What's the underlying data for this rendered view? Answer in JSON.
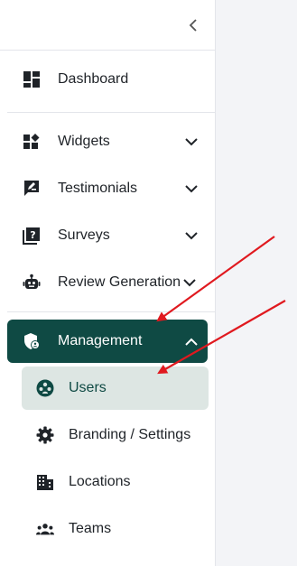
{
  "sidebar": {
    "collapse_icon": "chevron-left-icon",
    "items": [
      {
        "label": "Dashboard",
        "icon": "dashboard-icon"
      },
      {
        "label": "Widgets",
        "icon": "widgets-icon"
      },
      {
        "label": "Testimonials",
        "icon": "testimonial-icon"
      },
      {
        "label": "Surveys",
        "icon": "survey-icon"
      },
      {
        "label": "Review Generation",
        "icon": "robot-icon"
      },
      {
        "label": "Management",
        "icon": "shield-user-icon"
      }
    ],
    "management_children": [
      {
        "label": "Users",
        "icon": "users-circle-icon"
      },
      {
        "label": "Branding / Settings",
        "icon": "gear-icon"
      },
      {
        "label": "Locations",
        "icon": "building-icon"
      },
      {
        "label": "Teams",
        "icon": "team-icon"
      }
    ]
  },
  "colors": {
    "active_bg": "#0f4a44",
    "selected_bg": "#dde6e3",
    "annotation_arrow": "#e0191f",
    "text": "#1f2328"
  }
}
